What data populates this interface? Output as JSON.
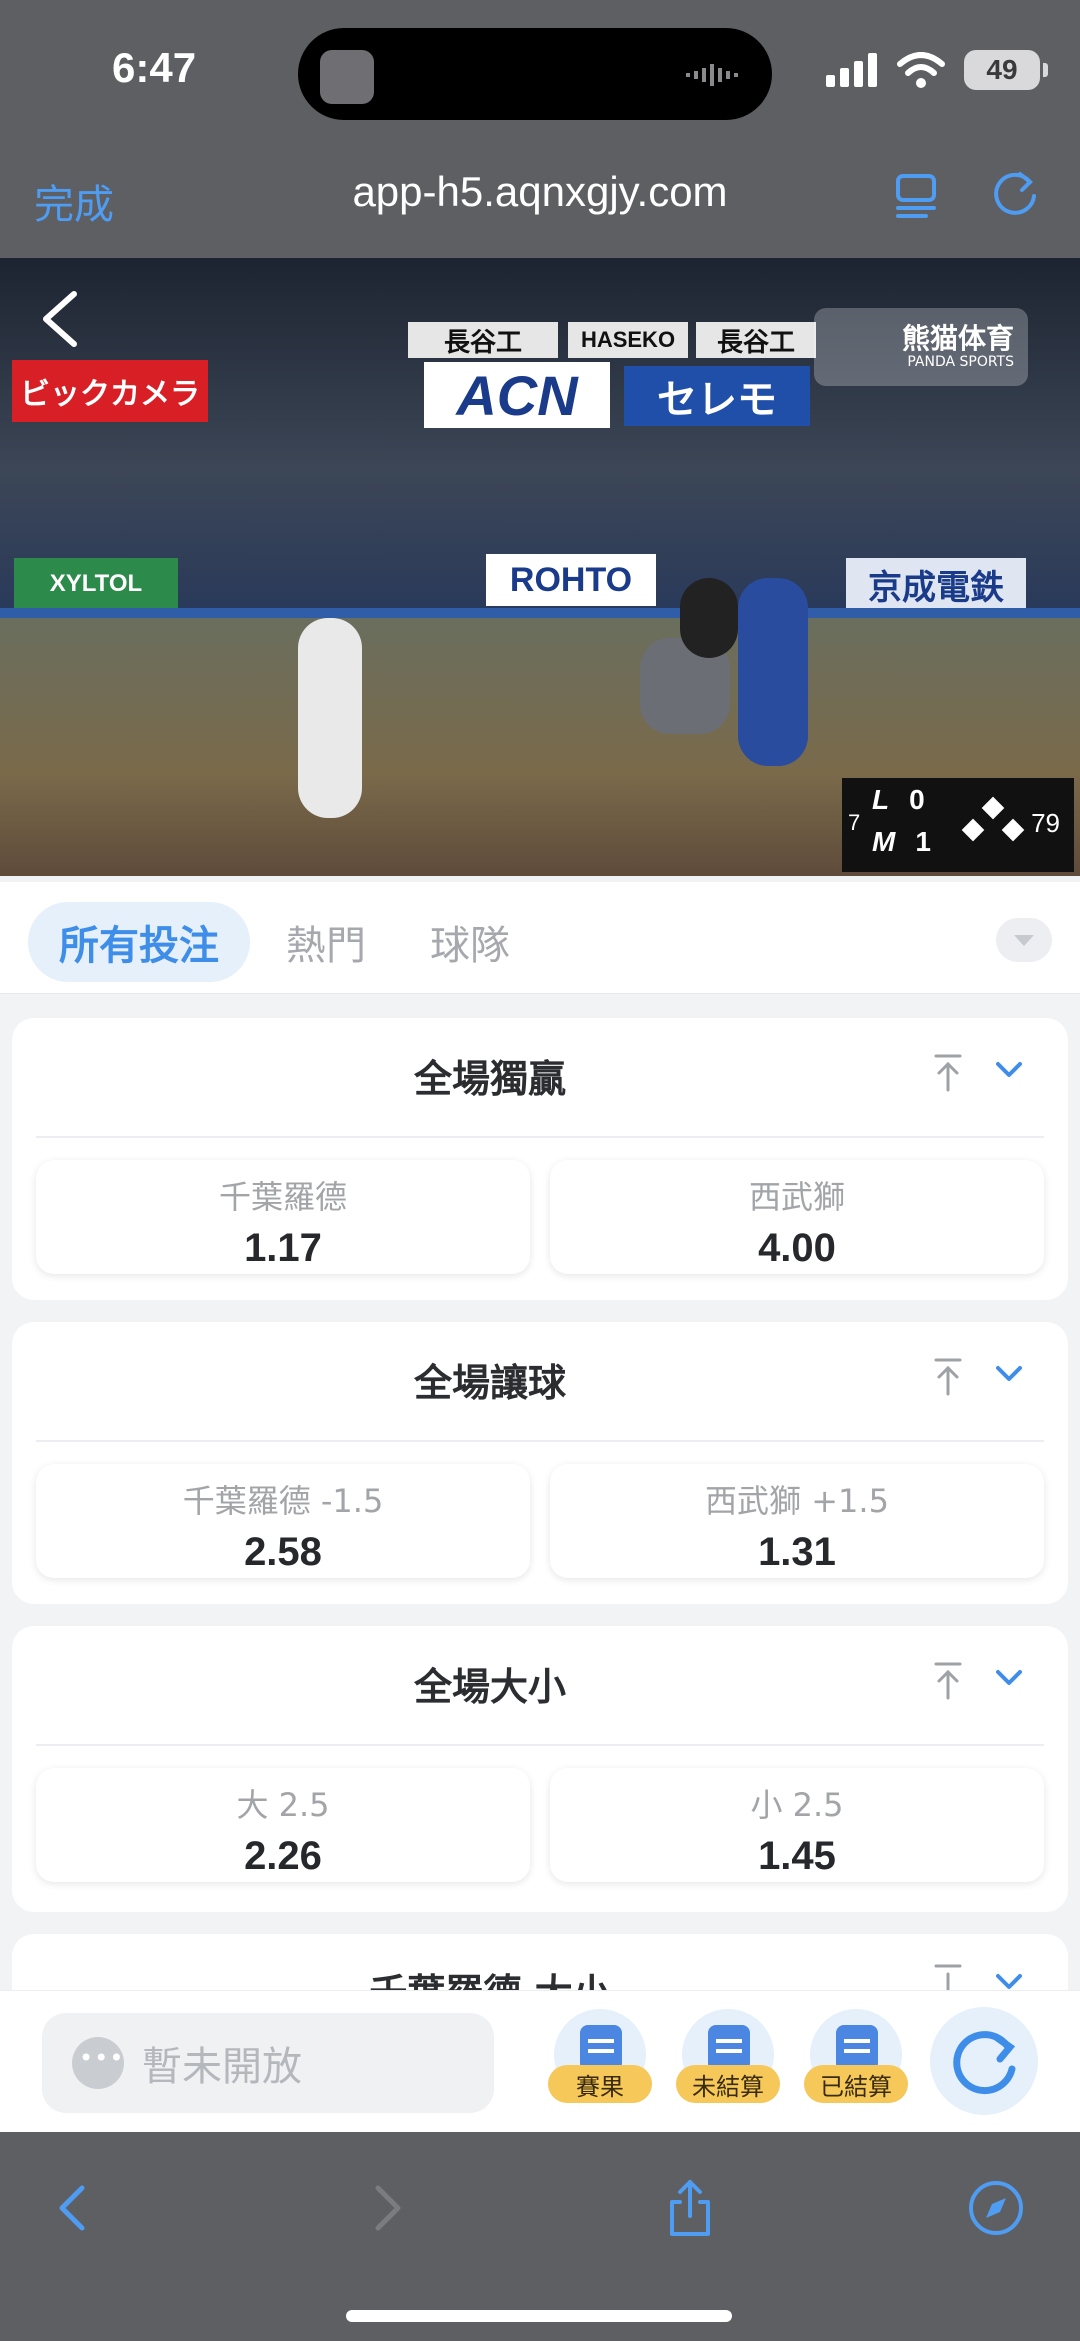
{
  "status_bar": {
    "time": "6:47",
    "battery": "49"
  },
  "browser": {
    "done_label": "完成",
    "url": "app-h5.aqnxgjy.com"
  },
  "video": {
    "watermark": "熊猫体育",
    "watermark_sub": "PANDA SPORTS",
    "banners": [
      "ビックカメラ",
      "ACN",
      "セレモ",
      "ROHTO",
      "京成電鉄",
      "長谷工",
      "HASEKO",
      "長谷工",
      "XYLTOL"
    ],
    "scorebug": {
      "team1": "L",
      "score1": "0",
      "team2": "M",
      "score2": "1",
      "inning": "7",
      "pitch_count": "79"
    }
  },
  "tabs": [
    {
      "label": "所有投注",
      "active": true
    },
    {
      "label": "熱門",
      "active": false
    },
    {
      "label": "球隊",
      "active": false
    }
  ],
  "markets": [
    {
      "title": "全場獨贏",
      "options": [
        {
          "label": "千葉羅德",
          "odds": "1.17"
        },
        {
          "label": "西武獅",
          "odds": "4.00"
        }
      ]
    },
    {
      "title": "全場讓球",
      "options": [
        {
          "label": "千葉羅德 -1.5",
          "odds": "2.58"
        },
        {
          "label": "西武獅 +1.5",
          "odds": "1.31"
        }
      ]
    },
    {
      "title": "全場大小",
      "options": [
        {
          "label": "大 2.5",
          "odds": "2.26"
        },
        {
          "label": "小 2.5",
          "odds": "1.45"
        }
      ]
    },
    {
      "title": "千葉羅德 大小"
    }
  ],
  "bottom_bar": {
    "chat_placeholder": "暫未開放",
    "buttons": [
      {
        "label": "賽果"
      },
      {
        "label": "未結算"
      },
      {
        "label": "已結算"
      }
    ]
  },
  "colors": {
    "accent": "#3e8ee9",
    "badge": "#f6c85a",
    "browser_chrome": "#5e5f63"
  }
}
